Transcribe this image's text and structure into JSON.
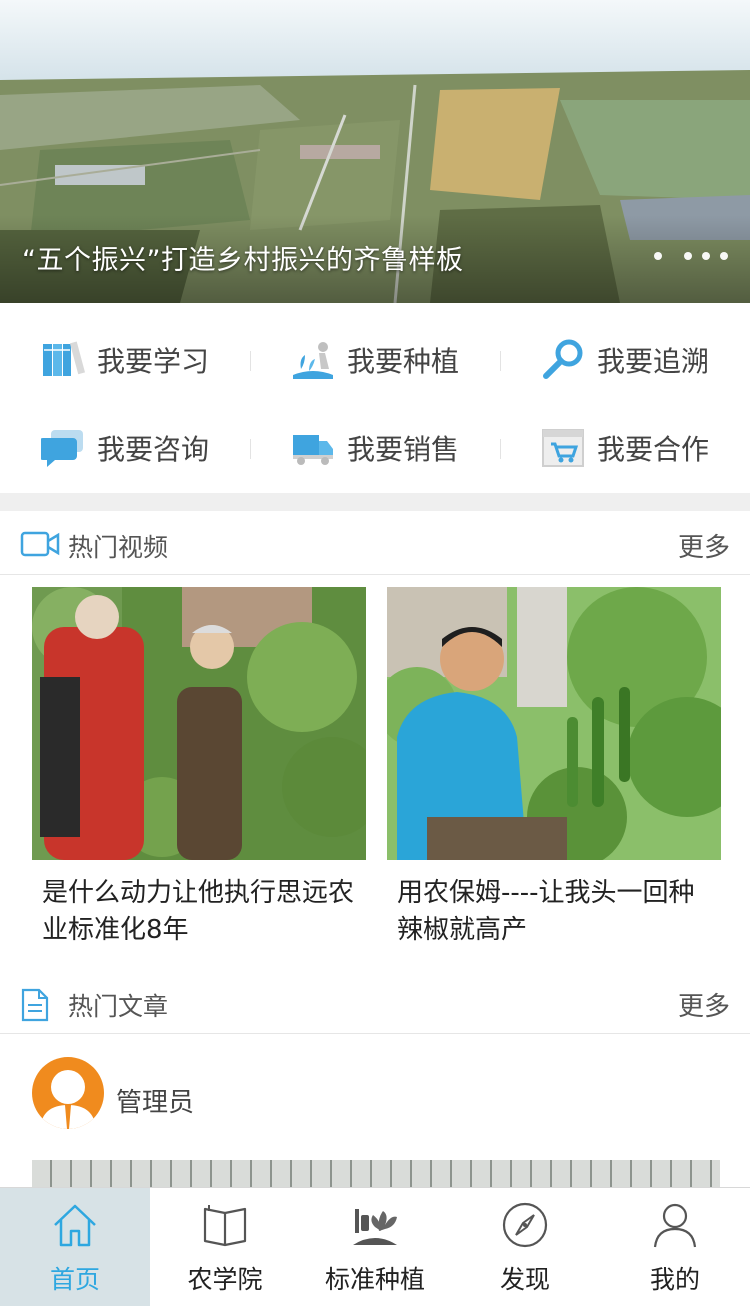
{
  "banner": {
    "caption": "“五个振兴”打造乡村振兴的齐鲁样板",
    "slide_count": 4,
    "active_slide": 1
  },
  "quick_actions": [
    {
      "label": "我要学习",
      "icon": "books-icon"
    },
    {
      "label": "我要种植",
      "icon": "planting-icon"
    },
    {
      "label": "我要追溯",
      "icon": "magnifier-icon"
    },
    {
      "label": "我要咨询",
      "icon": "chat-bubble-icon"
    },
    {
      "label": "我要销售",
      "icon": "truck-icon"
    },
    {
      "label": "我要合作",
      "icon": "shopping-cart-icon"
    }
  ],
  "hot_videos": {
    "title": "热门视频",
    "more": "更多",
    "items": [
      {
        "title": "是什么动力让他执行思远农业标准化8年"
      },
      {
        "title": "用农保姆----让我头一回种辣椒就高产"
      }
    ]
  },
  "hot_articles": {
    "title": "热门文章",
    "more": "更多",
    "author": "管理员"
  },
  "tabbar": {
    "items": [
      {
        "label": "首页",
        "icon": "home-icon",
        "active": true
      },
      {
        "label": "农学院",
        "icon": "book-icon",
        "active": false
      },
      {
        "label": "标准种植",
        "icon": "plant-tools-icon",
        "active": false
      },
      {
        "label": "发现",
        "icon": "compass-icon",
        "active": false
      },
      {
        "label": "我的",
        "icon": "user-icon",
        "active": false
      }
    ]
  },
  "colors": {
    "accent": "#2ea7e0",
    "avatar": "#f08b1e",
    "active_tab_bg": "#d7e2e6"
  }
}
